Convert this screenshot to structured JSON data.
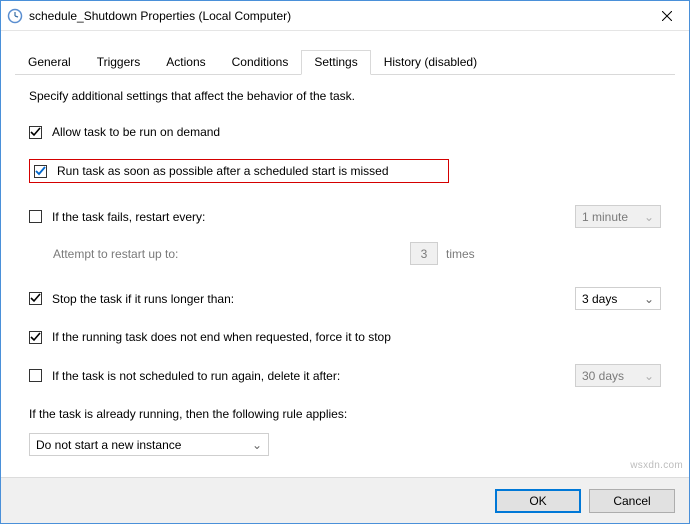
{
  "window": {
    "title": "schedule_Shutdown Properties (Local Computer)"
  },
  "tabs": {
    "general": "General",
    "triggers": "Triggers",
    "actions": "Actions",
    "conditions": "Conditions",
    "settings": "Settings",
    "history": "History (disabled)"
  },
  "settings": {
    "description": "Specify additional settings that affect the behavior of the task.",
    "allow_on_demand": {
      "label": "Allow task to be run on demand",
      "checked": true
    },
    "run_asap": {
      "label": "Run task as soon as possible after a scheduled start is missed",
      "checked": true
    },
    "restart_fail": {
      "label": "If the task fails, restart every:",
      "checked": false,
      "interval": "1 minute",
      "attempt_label": "Attempt to restart up to:",
      "attempt_count": "3",
      "times_label": "times"
    },
    "stop_longer": {
      "label": "Stop the task if it runs longer than:",
      "checked": true,
      "value": "3 days"
    },
    "force_stop": {
      "label": "If the running task does not end when requested, force it to stop",
      "checked": true
    },
    "delete_after": {
      "label": "If the task is not scheduled to run again, delete it after:",
      "checked": false,
      "value": "30 days"
    },
    "running_rule_label": "If the task is already running, then the following rule applies:",
    "running_rule_value": "Do not start a new instance"
  },
  "buttons": {
    "ok": "OK",
    "cancel": "Cancel"
  },
  "watermark": "wsxdn.com"
}
